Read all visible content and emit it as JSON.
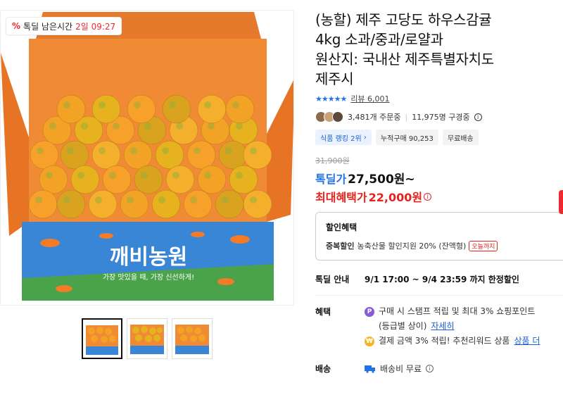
{
  "deal_badge": {
    "label": "톡딜 남은시간",
    "timer": "2일 09:27"
  },
  "product": {
    "title": "(농할) 제주 고당도 하우스감귤\n4kg 소과/중과/로얄과\n원산지: 국내산 제주특별자치도\n제주시",
    "rating_stars": "★★★★★",
    "review_label": "리뷰 6,001",
    "orders": "3,481개 주문중",
    "viewers": "11,975명 구경중",
    "ranking_tag": "식품 랭킹 2위",
    "cumulative_tag": "누적구매 90,253",
    "shipping_tag": "무료배송",
    "original_price": "31,900원",
    "deal_label": "톡딜가",
    "deal_price": "27,500원~",
    "max_benefit_label": "최대혜택가",
    "max_benefit_price": "22,000원"
  },
  "discount": {
    "title": "할인혜택",
    "line_strong": "중복할인",
    "line_text": "농축산물 할인지원 20% (잔액형)",
    "line_tag": "오늘까지"
  },
  "deal_info": {
    "label": "톡딜 안내",
    "value": "9/1 17:00 ~ 9/4 23:59 까지 한정할인"
  },
  "benefit": {
    "label": "혜택",
    "row1": "구매 시 스탬프 적립 및 최대 3% 쇼핑포인트",
    "row2_prefix": "(등급별 상이)",
    "row2_link": "자세히",
    "row3": "결제 금액 3% 적립! 추천리워드 상품",
    "row3_link": "상품 더"
  },
  "shipping": {
    "label": "배송",
    "value": "배송비 무료"
  },
  "image": {
    "box_label": "깨비농원",
    "box_slogan": "가장 맛있을 때, 가장 신선하게!"
  },
  "colors": {
    "accent_blue": "#2274e6",
    "accent_red": "#e8231e",
    "box_orange": "#e8762a",
    "box_blue": "#3b8be0"
  }
}
